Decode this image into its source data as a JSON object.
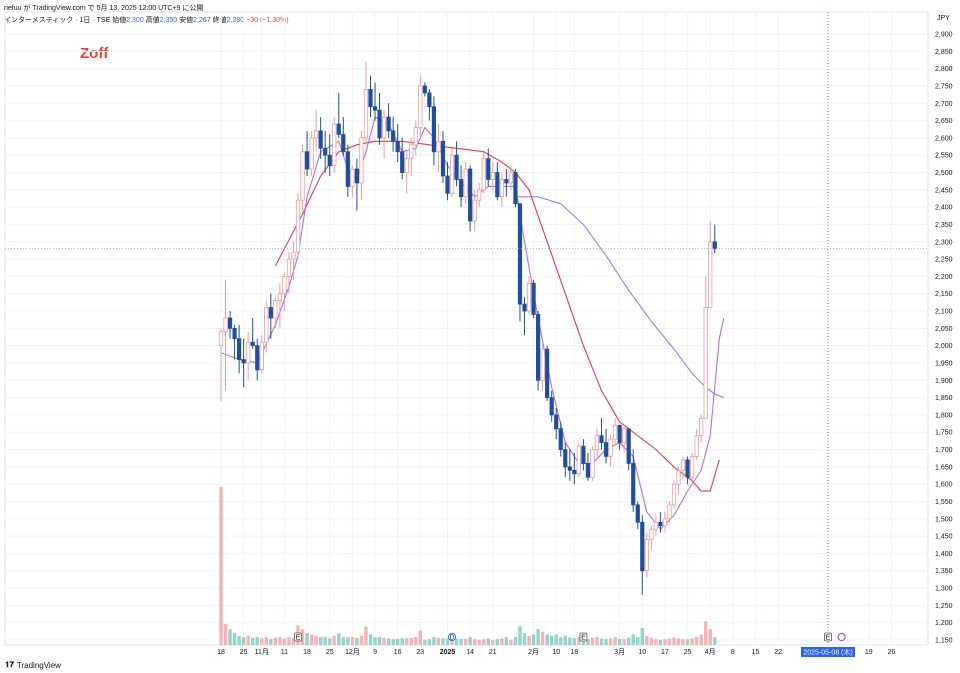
{
  "header": {
    "publish_line": "riefuu が TradingView.com で 5月 13, 2025 12:00 UTC+9 に公開",
    "symbol_line": "インターメスティック · 1日 · TSE",
    "open_label": "始値",
    "open_value": "2,300",
    "high_label": "高値",
    "high_value": "2,350",
    "low_label": "安値",
    "low_value": "2,267",
    "close_label": "終値",
    "close_value": "2,280",
    "change": "−30 (−1.30%)"
  },
  "brand_text": "Zoff",
  "currency": "JPY",
  "footer_logo": "TradingView",
  "colors": {
    "up": "#ef9a9a",
    "down": "#1f4e9c",
    "ma_short": "#b46ee0",
    "ma_mid": "#e53945",
    "ma_long": "#9b7be8",
    "vol_up": "#f4a6a6",
    "vol_down": "#7fcbc4",
    "crosshair": "#2962ff",
    "grid": "#f0f3fa"
  },
  "chart_data": {
    "type": "candlestick",
    "ylim": [
      1130,
      2960
    ],
    "y_ticks": [
      1150,
      1200,
      1250,
      1300,
      1350,
      1400,
      1450,
      1500,
      1550,
      1600,
      1650,
      1700,
      1750,
      1800,
      1850,
      1900,
      1950,
      2000,
      2050,
      2100,
      2150,
      2200,
      2250,
      2300,
      2350,
      2400,
      2450,
      2500,
      2550,
      2600,
      2650,
      2700,
      2750,
      2800,
      2850,
      2900
    ],
    "y_tick_labels": [
      "1,150",
      "1,200",
      "1,250",
      "1,300",
      "1,350",
      "1,400",
      "1,450",
      "1,500",
      "1,550",
      "1,600",
      "1,650",
      "1,700",
      "1,750",
      "1,800",
      "1,850",
      "1,900",
      "1,950",
      "2,000",
      "2,050",
      "2,100",
      "2,150",
      "2,200",
      "2,250",
      "2,300",
      "2,350",
      "2,400",
      "2,450",
      "2,500",
      "2,550",
      "2,600",
      "2,650",
      "2,700",
      "2,750",
      "2,800",
      "2,850",
      "2,900"
    ],
    "x_ticks": [
      {
        "i": 0,
        "label": "18"
      },
      {
        "i": 5,
        "label": "25"
      },
      {
        "i": 9,
        "label": "11月"
      },
      {
        "i": 14,
        "label": "11"
      },
      {
        "i": 19,
        "label": "18"
      },
      {
        "i": 24,
        "label": "25"
      },
      {
        "i": 29,
        "label": "12月"
      },
      {
        "i": 34,
        "label": "9"
      },
      {
        "i": 39,
        "label": "16"
      },
      {
        "i": 44,
        "label": "23"
      },
      {
        "i": 50,
        "label": "2025"
      },
      {
        "i": 55,
        "label": "14"
      },
      {
        "i": 60,
        "label": "21"
      },
      {
        "i": 69,
        "label": "2月"
      },
      {
        "i": 74,
        "label": "10"
      },
      {
        "i": 78,
        "label": "18"
      },
      {
        "i": 88,
        "label": "3月"
      },
      {
        "i": 93,
        "label": "10"
      },
      {
        "i": 98,
        "label": "17"
      },
      {
        "i": 103,
        "label": "25"
      },
      {
        "i": 108,
        "label": "4月"
      },
      {
        "i": 113,
        "label": "8"
      },
      {
        "i": 118,
        "label": "15"
      },
      {
        "i": 123,
        "label": "22"
      },
      {
        "i": 143,
        "label": "19"
      },
      {
        "i": 148,
        "label": "26"
      }
    ],
    "crosshair_label": "2025-05-08 (木)",
    "crosshair_index": 134,
    "last_price": 2280,
    "markers": [
      {
        "i": 17,
        "label": "E"
      },
      {
        "i": 51,
        "label": "D"
      },
      {
        "i": 80,
        "label": "E"
      },
      {
        "i": 134,
        "label": "E"
      }
    ],
    "candles": [
      [
        2000,
        2050,
        1840,
        2040,
        1200
      ],
      [
        2040,
        2190,
        1870,
        2080,
        160
      ],
      [
        2080,
        2100,
        2020,
        2050,
        120
      ],
      [
        2050,
        2060,
        1960,
        2020,
        90
      ],
      [
        2020,
        2060,
        1920,
        1960,
        70
      ],
      [
        1960,
        2020,
        1880,
        1950,
        60
      ],
      [
        1950,
        2040,
        1900,
        2010,
        70
      ],
      [
        2010,
        2080,
        1990,
        2000,
        55
      ],
      [
        2000,
        2020,
        1900,
        1930,
        60
      ],
      [
        1930,
        2030,
        1920,
        2010,
        50
      ],
      [
        2010,
        2130,
        1980,
        2110,
        60
      ],
      [
        2110,
        2150,
        2020,
        2080,
        45
      ],
      [
        2080,
        2140,
        2050,
        2130,
        55
      ],
      [
        2130,
        2180,
        2050,
        2150,
        60
      ],
      [
        2150,
        2210,
        2100,
        2200,
        50
      ],
      [
        2200,
        2270,
        2150,
        2250,
        60
      ],
      [
        2250,
        2300,
        2190,
        2270,
        55
      ],
      [
        2270,
        2440,
        2250,
        2420,
        150
      ],
      [
        2420,
        2580,
        2390,
        2560,
        120
      ],
      [
        2560,
        2620,
        2490,
        2510,
        90
      ],
      [
        2510,
        2620,
        2490,
        2600,
        80
      ],
      [
        2600,
        2680,
        2560,
        2620,
        70
      ],
      [
        2620,
        2660,
        2540,
        2570,
        60
      ],
      [
        2570,
        2620,
        2500,
        2550,
        60
      ],
      [
        2550,
        2610,
        2490,
        2520,
        50
      ],
      [
        2520,
        2660,
        2500,
        2640,
        70
      ],
      [
        2640,
        2730,
        2600,
        2610,
        90
      ],
      [
        2610,
        2660,
        2550,
        2560,
        60
      ],
      [
        2560,
        2580,
        2430,
        2460,
        60
      ],
      [
        2460,
        2520,
        2430,
        2510,
        60
      ],
      [
        2510,
        2540,
        2390,
        2470,
        55
      ],
      [
        2470,
        2620,
        2420,
        2600,
        70
      ],
      [
        2600,
        2820,
        2580,
        2740,
        140
      ],
      [
        2740,
        2780,
        2660,
        2690,
        80
      ],
      [
        2690,
        2760,
        2650,
        2680,
        60
      ],
      [
        2680,
        2730,
        2580,
        2600,
        60
      ],
      [
        2600,
        2680,
        2540,
        2660,
        55
      ],
      [
        2660,
        2700,
        2600,
        2620,
        50
      ],
      [
        2620,
        2660,
        2560,
        2590,
        45
      ],
      [
        2590,
        2640,
        2530,
        2560,
        45
      ],
      [
        2560,
        2600,
        2480,
        2500,
        50
      ],
      [
        2500,
        2560,
        2440,
        2540,
        50
      ],
      [
        2540,
        2600,
        2490,
        2580,
        55
      ],
      [
        2580,
        2650,
        2550,
        2630,
        60
      ],
      [
        2630,
        2780,
        2600,
        2750,
        110
      ],
      [
        2750,
        2760,
        2720,
        2730,
        40
      ],
      [
        2730,
        2740,
        2650,
        2690,
        45
      ],
      [
        2690,
        2720,
        2520,
        2560,
        60
      ],
      [
        2560,
        2640,
        2500,
        2590,
        55
      ],
      [
        2590,
        2620,
        2470,
        2490,
        50
      ],
      [
        2490,
        2530,
        2420,
        2440,
        50
      ],
      [
        2440,
        2570,
        2430,
        2550,
        55
      ],
      [
        2550,
        2590,
        2460,
        2480,
        50
      ],
      [
        2480,
        2520,
        2400,
        2430,
        45
      ],
      [
        2430,
        2530,
        2410,
        2510,
        45
      ],
      [
        2510,
        2520,
        2330,
        2360,
        60
      ],
      [
        2360,
        2450,
        2330,
        2420,
        45
      ],
      [
        2420,
        2470,
        2400,
        2450,
        40
      ],
      [
        2450,
        2560,
        2440,
        2540,
        45
      ],
      [
        2540,
        2570,
        2460,
        2480,
        50
      ],
      [
        2480,
        2530,
        2450,
        2500,
        40
      ],
      [
        2500,
        2530,
        2420,
        2430,
        45
      ],
      [
        2430,
        2500,
        2400,
        2480,
        50
      ],
      [
        2480,
        2510,
        2430,
        2470,
        60
      ],
      [
        2470,
        2520,
        2450,
        2500,
        40
      ],
      [
        2500,
        2510,
        2400,
        2410,
        60
      ],
      [
        2410,
        2240,
        2070,
        2120,
        140
      ],
      [
        2120,
        2140,
        2030,
        2100,
        90
      ],
      [
        2100,
        2200,
        2090,
        2180,
        70
      ],
      [
        2180,
        2190,
        2080,
        2090,
        80
      ],
      [
        2090,
        2100,
        1870,
        1900,
        120
      ],
      [
        1900,
        2010,
        1870,
        1990,
        100
      ],
      [
        1990,
        2000,
        1840,
        1850,
        80
      ],
      [
        1850,
        1870,
        1780,
        1800,
        70
      ],
      [
        1800,
        1820,
        1730,
        1760,
        80
      ],
      [
        1760,
        1780,
        1680,
        1700,
        60
      ],
      [
        1700,
        1720,
        1620,
        1650,
        70
      ],
      [
        1650,
        1700,
        1610,
        1640,
        55
      ],
      [
        1640,
        1690,
        1600,
        1630,
        50
      ],
      [
        1630,
        1720,
        1620,
        1710,
        60
      ],
      [
        1710,
        1730,
        1640,
        1660,
        50
      ],
      [
        1660,
        1690,
        1610,
        1620,
        45
      ],
      [
        1620,
        1710,
        1610,
        1700,
        55
      ],
      [
        1700,
        1760,
        1680,
        1740,
        60
      ],
      [
        1740,
        1790,
        1700,
        1720,
        50
      ],
      [
        1720,
        1760,
        1660,
        1680,
        45
      ],
      [
        1680,
        1740,
        1650,
        1730,
        50
      ],
      [
        1730,
        1790,
        1710,
        1770,
        60
      ],
      [
        1770,
        1770,
        1700,
        1720,
        45
      ],
      [
        1720,
        1770,
        1690,
        1760,
        45
      ],
      [
        1760,
        1760,
        1640,
        1660,
        55
      ],
      [
        1660,
        1700,
        1520,
        1540,
        80
      ],
      [
        1540,
        1550,
        1470,
        1490,
        60
      ],
      [
        1490,
        1510,
        1280,
        1350,
        130
      ],
      [
        1350,
        1460,
        1330,
        1440,
        70
      ],
      [
        1440,
        1480,
        1410,
        1470,
        55
      ],
      [
        1470,
        1510,
        1450,
        1490,
        45
      ],
      [
        1490,
        1520,
        1460,
        1480,
        40
      ],
      [
        1480,
        1520,
        1460,
        1500,
        45
      ],
      [
        1500,
        1550,
        1490,
        1540,
        50
      ],
      [
        1540,
        1610,
        1530,
        1600,
        55
      ],
      [
        1600,
        1650,
        1570,
        1640,
        50
      ],
      [
        1640,
        1680,
        1610,
        1670,
        45
      ],
      [
        1670,
        1680,
        1600,
        1620,
        45
      ],
      [
        1620,
        1690,
        1610,
        1680,
        50
      ],
      [
        1680,
        1760,
        1670,
        1740,
        60
      ],
      [
        1740,
        1800,
        1720,
        1790,
        80
      ],
      [
        1790,
        2200,
        2010,
        2110,
        180
      ],
      [
        2110,
        2360,
        2250,
        2300,
        120
      ],
      [
        2300,
        2350,
        2267,
        2280,
        60
      ]
    ],
    "ma_short": [
      [
        0,
        1980
      ],
      [
        4,
        1960
      ],
      [
        8,
        1950
      ],
      [
        12,
        2060
      ],
      [
        15,
        2170
      ],
      [
        17,
        2260
      ],
      [
        19,
        2430
      ],
      [
        22,
        2560
      ],
      [
        26,
        2590
      ],
      [
        28,
        2510
      ],
      [
        30,
        2480
      ],
      [
        32,
        2560
      ],
      [
        34,
        2660
      ],
      [
        37,
        2640
      ],
      [
        40,
        2560
      ],
      [
        43,
        2570
      ],
      [
        45,
        2630
      ],
      [
        47,
        2600
      ],
      [
        50,
        2520
      ],
      [
        53,
        2470
      ],
      [
        56,
        2430
      ],
      [
        59,
        2460
      ],
      [
        62,
        2460
      ],
      [
        65,
        2460
      ],
      [
        67,
        2300
      ],
      [
        70,
        2080
      ],
      [
        73,
        1880
      ],
      [
        76,
        1720
      ],
      [
        79,
        1660
      ],
      [
        82,
        1660
      ],
      [
        85,
        1700
      ],
      [
        88,
        1720
      ],
      [
        91,
        1680
      ],
      [
        94,
        1520
      ],
      [
        97,
        1470
      ],
      [
        100,
        1510
      ],
      [
        103,
        1580
      ],
      [
        106,
        1640
      ],
      [
        108,
        1740
      ],
      [
        110,
        2020
      ],
      [
        111,
        2080
      ]
    ],
    "ma_mid": [
      [
        12,
        2230
      ],
      [
        18,
        2380
      ],
      [
        22,
        2490
      ],
      [
        26,
        2560
      ],
      [
        30,
        2580
      ],
      [
        34,
        2590
      ],
      [
        40,
        2590
      ],
      [
        46,
        2580
      ],
      [
        52,
        2570
      ],
      [
        58,
        2560
      ],
      [
        62,
        2530
      ],
      [
        65,
        2500
      ],
      [
        68,
        2450
      ],
      [
        72,
        2300
      ],
      [
        76,
        2150
      ],
      [
        80,
        2000
      ],
      [
        84,
        1870
      ],
      [
        88,
        1780
      ],
      [
        92,
        1740
      ],
      [
        96,
        1700
      ],
      [
        100,
        1650
      ],
      [
        104,
        1610
      ],
      [
        106,
        1580
      ],
      [
        108,
        1580
      ],
      [
        110,
        1670
      ]
    ],
    "ma_long": [
      [
        65,
        2430
      ],
      [
        70,
        2430
      ],
      [
        75,
        2410
      ],
      [
        80,
        2350
      ],
      [
        85,
        2260
      ],
      [
        90,
        2160
      ],
      [
        95,
        2070
      ],
      [
        100,
        1990
      ],
      [
        104,
        1920
      ],
      [
        107,
        1880
      ],
      [
        109,
        1860
      ],
      [
        111,
        1850
      ]
    ]
  }
}
